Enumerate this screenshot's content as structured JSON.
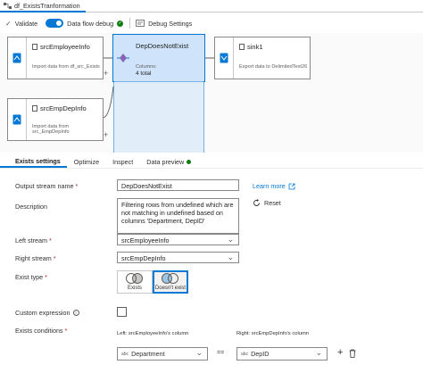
{
  "tab": {
    "title": "df_ExistsTranformation"
  },
  "toolbar": {
    "validate": "Validate",
    "debug": "Data flow debug",
    "debug_settings": "Debug Settings"
  },
  "nodes": {
    "src1": {
      "name": "srcEmployeeInfo",
      "desc": "Import data from df_src_Exists"
    },
    "exists": {
      "name": "DepDoesNotExist",
      "columns_label": "Columns:",
      "columns_value": "4 total"
    },
    "sink": {
      "name": "sink1",
      "desc": "Export data to DelimitedText26"
    },
    "src2": {
      "name": "srcEmpDepInfo",
      "desc_l1": "Import data from",
      "desc_l2": "src_EmpDepInfo"
    },
    "plus": "+"
  },
  "settings_tabs": [
    "Exists settings",
    "Optimize",
    "Inspect",
    "Data preview"
  ],
  "form": {
    "output_label": "Output stream name",
    "output_value": "DepDoesNotExist",
    "learn_more": "Learn more",
    "description_label": "Description",
    "description_value": "Filtering rows from undefined which are not matching in undefined based on columns 'Department, DepID'",
    "reset": "Reset",
    "left_label": "Left stream",
    "left_value": "srcEmployeeInfo",
    "right_label": "Right stream",
    "right_value": "srcEmpDepInfo",
    "exist_type_label": "Exist type",
    "exists_opt": "Exists",
    "not_exists_opt": "Doesn't exist",
    "custom_expr_label": "Custom expression",
    "conditions_label": "Exists conditions",
    "left_col_head": "Left: srcEmployeeInfo's column",
    "right_col_head": "Right: srcEmpDepInfo's column",
    "left_col": "Department",
    "operator": "==",
    "right_col": "DepID",
    "abc": "abc",
    "required_mark": "*"
  },
  "colors": {
    "accent": "#0078d4",
    "success": "#107c10",
    "canvas": "#fafafa"
  }
}
